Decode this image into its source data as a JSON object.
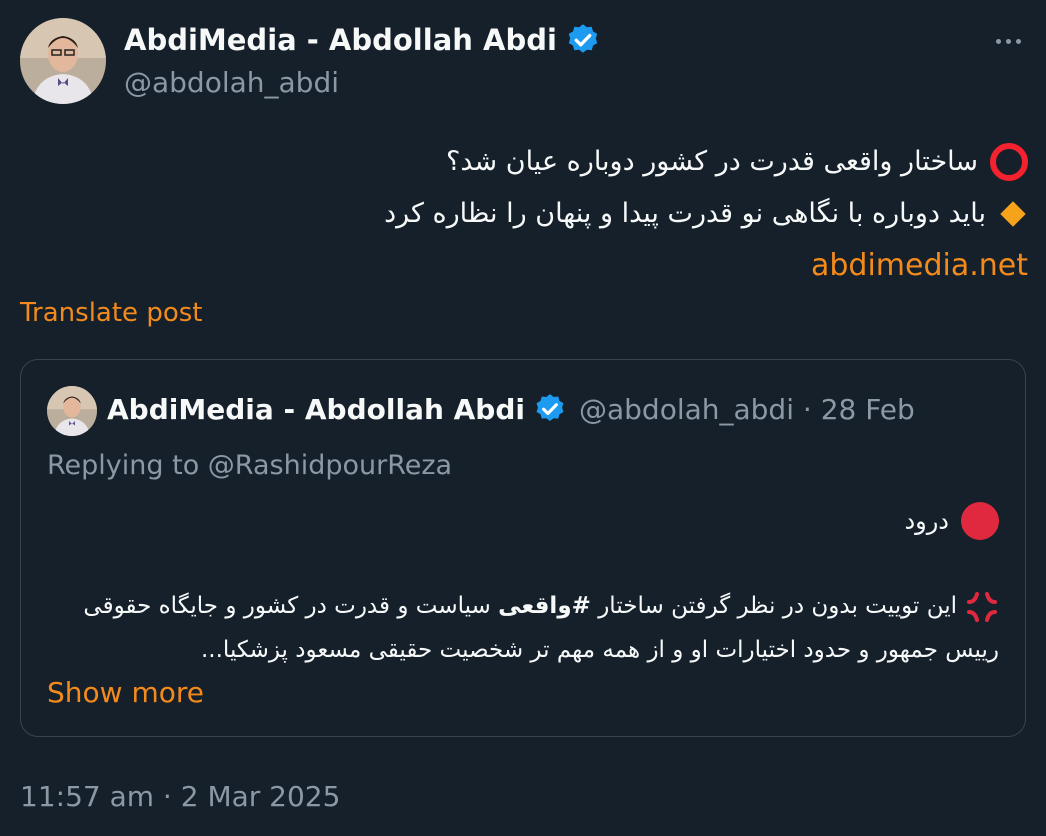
{
  "post": {
    "author_name": "AbdiMedia - Abdollah Abdi",
    "handle": "@abdolah_abdi",
    "lines": [
      "ساختار واقعی قدرت در کشور دوباره عیان شد؟",
      "باید دوباره با نگاهی نو قدرت پیدا و پنهان را نظاره کرد"
    ],
    "link": "abdimedia.net",
    "translate_label": "Translate post",
    "timestamp": "11:57 am · 2 Mar 2025"
  },
  "quote": {
    "author_name": "AbdiMedia - Abdollah Abdi",
    "meta": "@abdolah_abdi · 28 Feb",
    "replying": "Replying to @RashidpourReza",
    "greeting": "درود",
    "text_part1": "این توییت بدون در نظر گرفتن ساختار ",
    "hashtag": "#واقعی",
    "text_part2": " سیاست و قدرت در کشور و جایگاه حقوقی رییس جمهور و حدود اختیارات او و از همه مهم تر شخصیت حقیقی مسعود پزشکیا...",
    "show_more": "Show more"
  },
  "icons": {
    "verified": "verified-badge-icon",
    "more": "more-icon",
    "circle": "red-circle-outline-icon",
    "diamond": "orange-diamond-icon",
    "red_dot": "red-circle-icon",
    "anger": "anger-symbol-icon"
  },
  "colors": {
    "background": "#15202b",
    "accent": "#f28a1c",
    "secondary_text": "#8b98a5",
    "verified": "#1d9bf0",
    "border": "#38444d"
  }
}
